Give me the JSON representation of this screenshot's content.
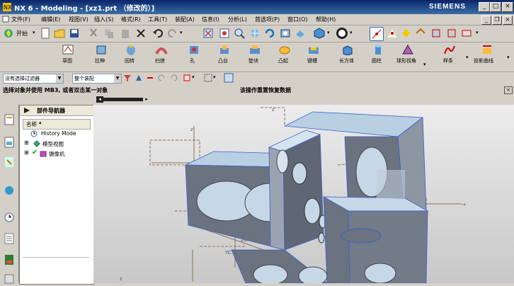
{
  "window": {
    "title": "NX 6 - Modeling - [xz1.prt （修改的）]",
    "brand": "SIEMENS"
  },
  "menu": [
    "文件(F)",
    "编辑(E)",
    "视图(V)",
    "插入(S)",
    "格式(R)",
    "工具(T)",
    "装配(A)",
    "信息(I)",
    "分析(L)",
    "首选项(P)",
    "窗口(O)",
    "帮助(H)"
  ],
  "toolbar1": {
    "start_label": "开始"
  },
  "toolbar2": {
    "items": [
      "草图",
      "拉伸",
      "回转",
      "扫掠",
      "孔",
      "凸台",
      "垫块",
      "凸起",
      "键槽",
      "长方体",
      "圆柱",
      "球形拐角",
      "样条",
      "投影曲线"
    ]
  },
  "filters": {
    "type_filter": "没有选择过滤器",
    "scope": "整个装配"
  },
  "cue": {
    "left": "选择对象并使用 MB3, 或者双击某一对象",
    "right": "该操作重置恢复数据"
  },
  "navigator": {
    "title": "部件导航器",
    "column": "名称",
    "rows": [
      "History Mode",
      "模型视图",
      "摄像机"
    ]
  },
  "colors": {
    "titlebar": "#0a246a",
    "model_face": "#6b7380",
    "model_edge": "#c6d8e8"
  }
}
